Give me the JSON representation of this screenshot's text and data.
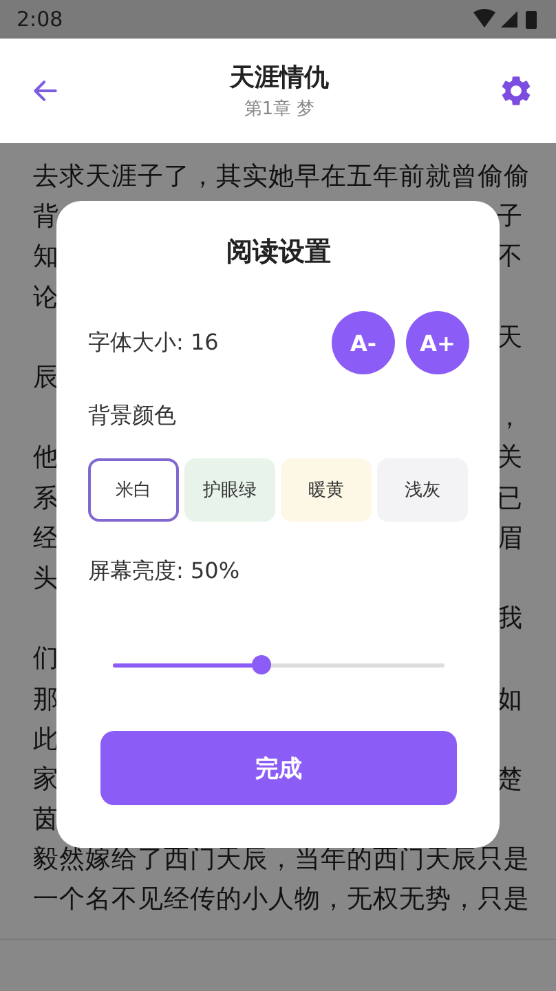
{
  "status_bar": {
    "time": "2:08"
  },
  "header": {
    "title": "天涯情仇",
    "subtitle": "第1章 梦"
  },
  "content": {
    "lines": [
      {
        "left": "去求天涯子了，其实她早在五年前就曾偷偷"
      },
      {
        "left": "背",
        "right": "子"
      },
      {
        "left": "知",
        "right": "不"
      },
      {
        "left": "论"
      },
      {
        "right": "天"
      },
      {
        "left": "辰"
      },
      {
        "right": "，"
      },
      {
        "left": "他",
        "right": "关"
      },
      {
        "left": "系",
        "right": "已"
      },
      {
        "left": "经",
        "right": "眉"
      },
      {
        "left": "头"
      },
      {
        "right": "我"
      },
      {
        "left": "们"
      },
      {
        "left": "那",
        "right": "如"
      },
      {
        "left": "此"
      },
      {
        "left": "家",
        "right": "楚"
      },
      {
        "left": "茵"
      },
      {
        "left": "毅然嫁给了西门天辰，当年的西门天辰只是"
      },
      {
        "left": "一个名不见经传的小人物，无权无势，只是"
      }
    ]
  },
  "dialog": {
    "title": "阅读设置",
    "font_size": {
      "label": "字体大小: 16",
      "buttons": [
        "A-",
        "A+"
      ]
    },
    "background": {
      "label": "背景颜色",
      "options": [
        {
          "label": "米白",
          "color": "#ffffff",
          "selected": true
        },
        {
          "label": "护眼绿",
          "color": "#e8f3ea",
          "selected": false
        },
        {
          "label": "暖黄",
          "color": "#fdf8e6",
          "selected": false
        },
        {
          "label": "浅灰",
          "color": "#f3f3f5",
          "selected": false
        }
      ]
    },
    "brightness": {
      "label": "屏幕亮度: 50%",
      "level": 0.45
    },
    "done": "完成"
  }
}
